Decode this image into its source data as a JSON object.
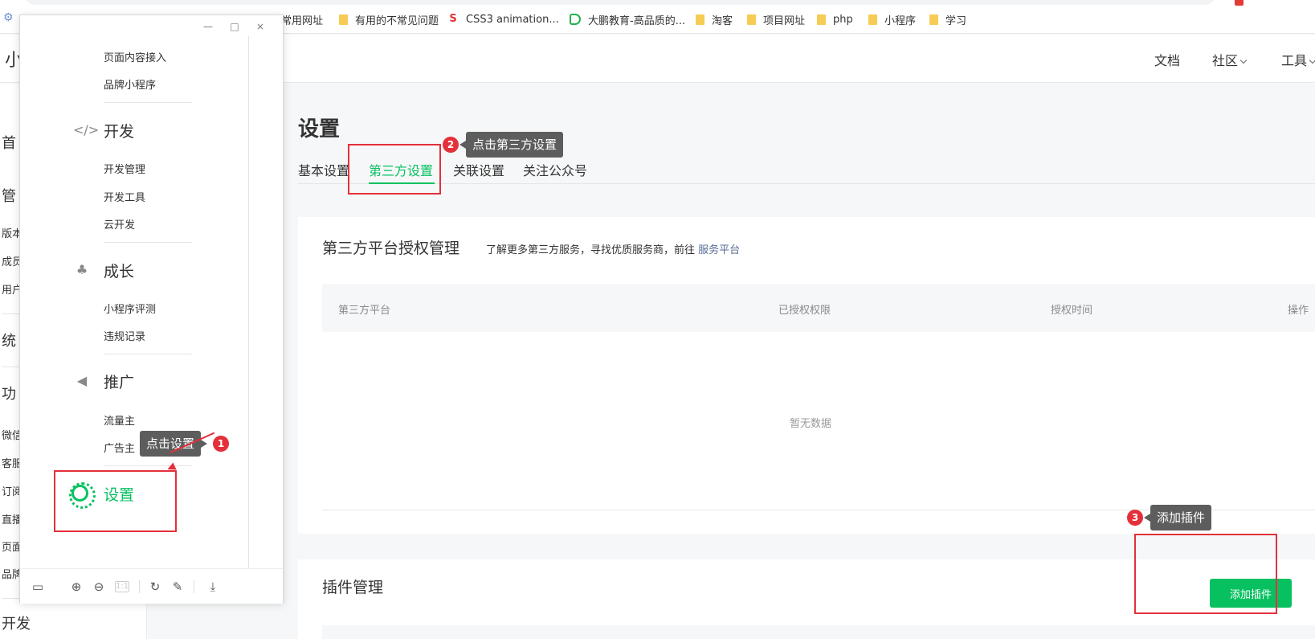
{
  "bookmarks": [
    {
      "label": "常用网址",
      "type": "folder"
    },
    {
      "label": "有用的不常见问题",
      "type": "folder"
    },
    {
      "label": "CSS3 animation...",
      "type": "css"
    },
    {
      "label": "大鹏教育-高品质的...",
      "type": "dp"
    },
    {
      "label": "淘客",
      "type": "folder"
    },
    {
      "label": "项目网址",
      "type": "folder"
    },
    {
      "label": "php",
      "type": "folder"
    },
    {
      "label": "小程序",
      "type": "folder"
    },
    {
      "label": "学习",
      "type": "folder"
    }
  ],
  "topnav": {
    "brand": "小",
    "docs": "文档",
    "community": "社区",
    "tools": "工具"
  },
  "bg_sidebar": {
    "items": [
      "首",
      "管",
      "版本",
      "成员",
      "用户",
      "统",
      "功",
      "微信",
      "客服",
      "订阅",
      "直播",
      "页面",
      "品牌",
      "开发"
    ]
  },
  "main": {
    "title": "设置",
    "tabs": [
      "基本设置",
      "第三方设置",
      "关联设置",
      "关注公众号"
    ],
    "third_party": {
      "title": "第三方平台授权管理",
      "desc": "了解更多第三方服务，寻找优质服务商，前往",
      "link": "服务平台",
      "columns": [
        "第三方平台",
        "已授权权限",
        "授权时间",
        "操作"
      ],
      "empty": "暂无数据"
    },
    "plugin": {
      "title": "插件管理",
      "add_button": "添加插件"
    }
  },
  "panel": {
    "window_controls": [
      "—",
      "□",
      "×"
    ],
    "items_top": [
      "页面内容接入",
      "品牌小程序"
    ],
    "dev": {
      "title": "开发",
      "items": [
        "开发管理",
        "开发工具",
        "云开发"
      ]
    },
    "growth": {
      "title": "成长",
      "items": [
        "小程序评测",
        "违规记录"
      ]
    },
    "promo": {
      "title": "推广",
      "items": [
        "流量主",
        "广告主"
      ]
    },
    "settings": "设置",
    "toolbar_icons": [
      "layout-icon",
      "zoom-in-icon",
      "zoom-out-icon",
      "actual-size-icon",
      "rotate-icon",
      "edit-icon",
      "download-icon"
    ],
    "actual_size_label": "1:1"
  },
  "annotations": {
    "step1": {
      "num": "1",
      "text": "点击设置"
    },
    "step2": {
      "num": "2",
      "text": "点击第三方设置"
    },
    "step3": {
      "num": "3",
      "text": "添加插件"
    }
  },
  "colors": {
    "accent": "#07c160",
    "highlight": "#e3303b",
    "link": "#576b95"
  }
}
